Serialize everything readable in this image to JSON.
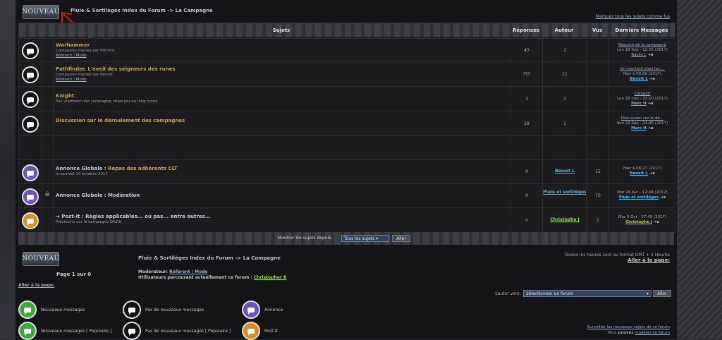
{
  "breadcrumb": {
    "forum": "Pluie & Sortilèges Index du Forum",
    "sep": " -> ",
    "section": "La Campagne"
  },
  "logo_text": "NOUVEAU",
  "mark_all_read": "Marquez tous les sujets comme lus",
  "headers": {
    "subjects": "Sujets",
    "replies": "Réponses",
    "author": "Auteur",
    "views": "Vus",
    "last": "Derniers Messages"
  },
  "topics": [
    {
      "title": "Warhammer",
      "sub1": "Campagne menée par Pierrick",
      "sub2": "Référent / Modo",
      "replies": "43",
      "author": "2",
      "views": "",
      "last1": "Résumé de la campagne",
      "last2": "Lun 18 Sep - 12:25 (2017)",
      "last3": "Basile L"
    },
    {
      "title": "Pathfinder, L'éveil des seigneurs des runes",
      "sub1": "Campagne menée par Benoit.",
      "sub2": "Référent / Modo",
      "replies": "755",
      "author": "11",
      "views": "",
      "last1": "Un courtard chez les ...",
      "last2": "Hier à 09:50 (2017)",
      "last3": "Benoit L"
    },
    {
      "title": "Knight",
      "sub1": "Pas vraiment une campagne, mais jeu au long cours.",
      "sub2": "",
      "replies": "3",
      "author": "1",
      "views": "",
      "last1": "Camelot",
      "last2": "Lun 18 Sep - 21:10 (2017)",
      "last3": "Marc H"
    },
    {
      "title": "Discussion sur le déroulement des campagnes",
      "sub1": "",
      "sub2": "",
      "replies": "18",
      "author": "1",
      "views": "",
      "last1": "Discussion sur le dé...",
      "last2": "Ven 22 Sep - 13:45 (2017)",
      "last3": "Marc H"
    }
  ],
  "announcements": [
    {
      "prefix": "Annonce Globale : ",
      "title": "Repas des adhérents CLT",
      "sub": "le samedi 14 octobre 2017",
      "replies": "0",
      "author": "Benoit L",
      "views": "15",
      "last1": "Hier à 08:27 (2017)",
      "last2": "Benoit L",
      "color": "#6b4fc7"
    },
    {
      "prefix": "Annonce Globale : ",
      "title": "Modération",
      "sub": "",
      "replies": "0",
      "author": "Pluie et sortilèges",
      "views": "70",
      "last1": "Mer 26 Avr - 12:48 (2017)",
      "last2": "Pluie et sortilèges",
      "color": "#6b4fc7"
    },
    {
      "prefix": "➜ Post-it : ",
      "title": "Règles applicables... où pas... entre autres...",
      "sub": "Précisions sur la campagne D&D5",
      "replies": "0",
      "author": "Christophe J",
      "views": "2",
      "last1": "Mar 3 Oct - 17:49 (2017)",
      "last2": "Christophe J",
      "color": "#e08a1e"
    }
  ],
  "show_since_label": "Montrer les sujets depuis:",
  "show_since_value": "Tous les sujets",
  "go_button": "Aller",
  "page_info": "Page 1 sur 0",
  "moderator_label": "Modérateur: ",
  "moderator": "Référent / Modo",
  "browsing_label": "Utilisateurs parcourant actuellement ce forum : ",
  "browsing_user": "Christopher B",
  "timezone": "Toutes les heures sont au format GMT + 2 Heures",
  "goto_page": "Aller à la page:",
  "goto_page_left": "Aller à la page:",
  "jump_label": "Sauter vers:",
  "jump_value": "Sélectionner un forum",
  "legend": {
    "new": "Nouveaux messages",
    "no_new": "Pas de nouveaux messages",
    "announce": "Annonce",
    "new_pop": "Nouveaux messages [ Populaire ]",
    "no_new_pop": "Pas de nouveaux messages [ Populaire ]",
    "postit": "Post-it"
  },
  "watch_link": "Surveiller les nouveaux sujets de ce forum",
  "moderate_text_a": "Vous ",
  "moderate_text_b": "pouvez",
  "moderate_link": "modérer ce forum",
  "colors": {
    "accent_gold": "#c9a453",
    "user_blue": "#5ab4e8",
    "user_green": "#9ad649",
    "new_green": "#3aa83a",
    "announce": "#6b4fc7",
    "postit": "#e08a1e"
  }
}
